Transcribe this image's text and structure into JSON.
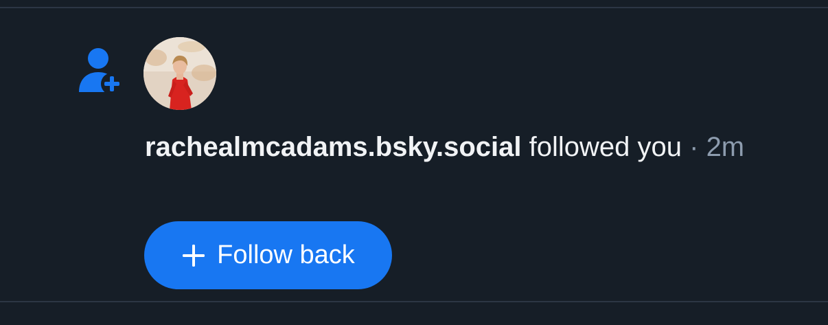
{
  "notification": {
    "handle": "rachealmcadams.bsky.social",
    "action": "followed you",
    "separator": "·",
    "timestamp": "2m",
    "follow_back_label": "Follow back",
    "icons": {
      "type": "person-plus-icon",
      "button": "plus-icon"
    },
    "colors": {
      "background": "#161e27",
      "accent": "#1877f2",
      "text": "#f1f3f5",
      "muted": "#8d9cae"
    }
  }
}
